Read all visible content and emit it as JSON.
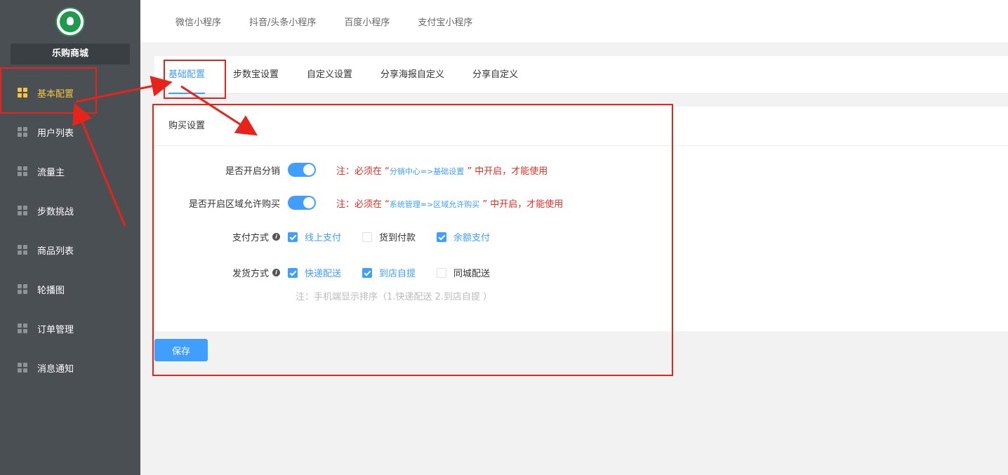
{
  "sidebar": {
    "shop_name": "乐购商城",
    "items": [
      {
        "label": "基本配置",
        "active": true
      },
      {
        "label": "用户列表",
        "active": false
      },
      {
        "label": "流量主",
        "active": false
      },
      {
        "label": "步数挑战",
        "active": false
      },
      {
        "label": "商品列表",
        "active": false
      },
      {
        "label": "轮播图",
        "active": false
      },
      {
        "label": "订单管理",
        "active": false
      },
      {
        "label": "消息通知",
        "active": false
      }
    ]
  },
  "top_tabs": [
    "微信小程序",
    "抖音/头条小程序",
    "百度小程序",
    "支付宝小程序"
  ],
  "sub_tabs": [
    {
      "label": "基础配置",
      "active": true
    },
    {
      "label": "步数宝设置",
      "active": false
    },
    {
      "label": "自定义设置",
      "active": false
    },
    {
      "label": "分享海报自定义",
      "active": false
    },
    {
      "label": "分享自定义",
      "active": false
    }
  ],
  "card": {
    "title": "购买设置",
    "distribution": {
      "label": "是否开启分销",
      "enabled": true,
      "note_prefix": "注：必须在 “",
      "note_link": "分销中心=>基础设置",
      "note_suffix": " ” 中开启，才能使用"
    },
    "region": {
      "label": "是否开启区域允许购买",
      "enabled": true,
      "note_prefix": "注：必须在 “",
      "note_link": "系统管理=>区域允许购买",
      "note_suffix": " ” 中开启，才能使用"
    },
    "payment": {
      "label": "支付方式",
      "options": [
        {
          "label": "线上支付",
          "checked": true
        },
        {
          "label": "货到付款",
          "checked": false
        },
        {
          "label": "余额支付",
          "checked": true
        }
      ]
    },
    "shipping": {
      "label": "发货方式",
      "options": [
        {
          "label": "快递配送",
          "checked": true
        },
        {
          "label": "到店自提",
          "checked": true
        },
        {
          "label": "同城配送",
          "checked": false
        }
      ],
      "hint": "注：手机端显示排序（1.快递配送 2.到店自提 ）"
    }
  },
  "save_label": "保存",
  "colors": {
    "accent": "#409eff",
    "sidebar": "#4a4f54",
    "active_menu": "#f5c542",
    "annotation": "#e8231a"
  }
}
